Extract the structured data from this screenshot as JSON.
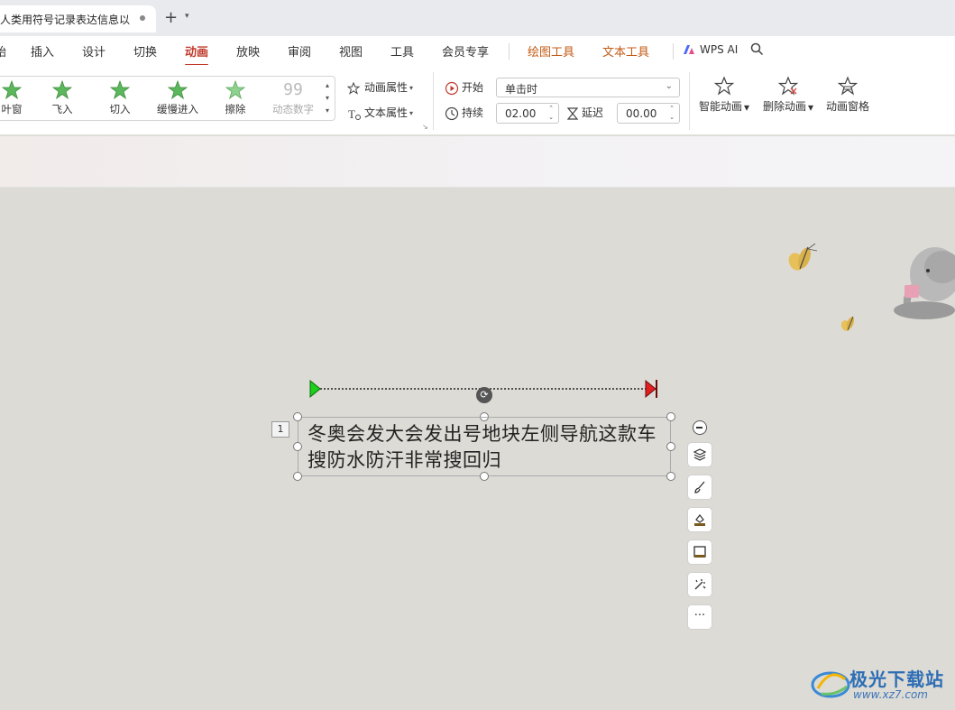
{
  "titlebar": {
    "doc_tab_title": "人类用符号记录表达信息以",
    "new_tab_icon": "plus-icon"
  },
  "menu": {
    "partial_left": "始",
    "items": [
      "插入",
      "设计",
      "切换",
      "动画",
      "放映",
      "审阅",
      "视图",
      "工具",
      "会员专享"
    ],
    "active": "动画",
    "context_tabs": [
      "绘图工具",
      "文本工具"
    ],
    "ai_label": "WPS AI"
  },
  "ribbon": {
    "animations": [
      {
        "label": "叶窗",
        "icon": "star-icon"
      },
      {
        "label": "飞入",
        "icon": "star-icon"
      },
      {
        "label": "切入",
        "icon": "star-icon"
      },
      {
        "label": "缓慢进入",
        "icon": "star-icon"
      },
      {
        "label": "擦除",
        "icon": "star-icon"
      },
      {
        "label": "动态数字",
        "icon": "number-99-icon",
        "glyph": "99"
      }
    ],
    "anim_props": "动画属性",
    "text_props": "文本属性",
    "start_label": "开始",
    "start_value": "单击时",
    "duration_label": "持续",
    "duration_value": "02.00",
    "delay_label": "延迟",
    "delay_value": "00.00",
    "smart_anim": "智能动画",
    "delete_anim": "删除动画",
    "anim_pane": "动画窗格"
  },
  "slide": {
    "anim_index": "1",
    "text": "冬奥会发大会发出号地块左侧导航这款车搜防水防汗非常搜回归",
    "rotate_icon": "rotate-icon"
  },
  "float_toolbar": [
    "collapse-icon",
    "layers-icon",
    "brush-icon",
    "fill-icon",
    "border-icon",
    "magic-icon",
    "more-icon"
  ],
  "float_more": "···",
  "watermark": {
    "name": "极光下载站",
    "url": "www.xz7.com"
  },
  "colors": {
    "accent": "#c0392b",
    "context_tab": "#c45a14",
    "star_green": "#5cb85c",
    "canvas": "#dddbd5"
  }
}
